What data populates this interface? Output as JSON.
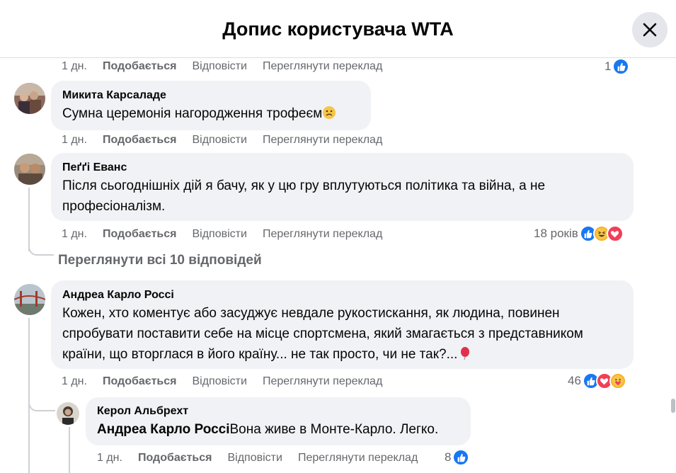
{
  "header": {
    "title": "Допис користувача WTA",
    "close_icon": "close-icon"
  },
  "actions": {
    "like": "Подобається",
    "reply": "Відповісти",
    "translate": "Переглянути переклад"
  },
  "comments": [
    {
      "time": "1 дн.",
      "reaction_count": "1",
      "reactions": [
        "like"
      ]
    },
    {
      "author": "Микита Карсаладе",
      "text": "Сумна церемонія нагородження трофеєм",
      "emoji": "sad-face-emoji",
      "time": "1 дн.",
      "reaction_count": ""
    },
    {
      "author": "Пеґґі Еванс",
      "text_line1": "Після сьогоднішніх дій я бачу, як у цю гру вплутуються політика та війна, а не",
      "text_line2": "професіоналізм.",
      "time": "1 дн.",
      "reaction_count": "18 років",
      "reactions": [
        "like",
        "haha",
        "love"
      ],
      "view_replies": "Переглянути всі 10 відповідей"
    },
    {
      "author": "Андреа Карло Россі",
      "text_line1": "Кожен, хто коментує або засуджує невдале рукостискання, як людина, повинен",
      "text_line2": "спробувати поставити себе на місце спортсмена, який змагається з представником",
      "text_line3": "країни, що вторглася в його країну... не так просто, чи не так?...",
      "emoji": "balloon-emoji",
      "time": "1 дн.",
      "reaction_count": "46",
      "reactions": [
        "like",
        "love",
        "care"
      ]
    },
    {
      "author": "Керол Альбрехт",
      "mention": "Андреа Карло Россі",
      "text": "Вона живе в Монте-Карло. Легко.",
      "time": "1 дн.",
      "reaction_count": "8",
      "reactions": [
        "like"
      ]
    }
  ],
  "colors": {
    "like": "#1877f2",
    "love": "#f33e58",
    "haha": "#f7b125",
    "bubble": "#f0f2f5",
    "meta": "#65676b"
  }
}
